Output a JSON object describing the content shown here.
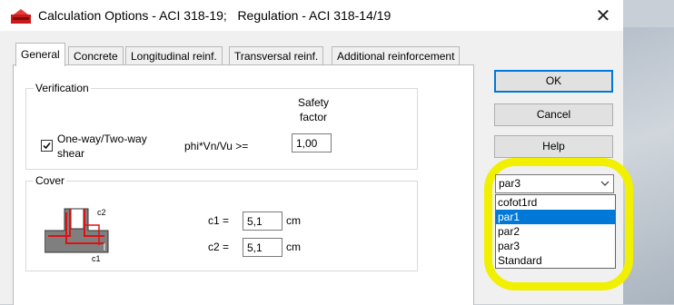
{
  "window": {
    "title": "Calculation Options - ACI 318-19;   Regulation - ACI 318-14/19",
    "close_glyph": "✕"
  },
  "tabs": [
    "General",
    "Concrete",
    "Longitudinal reinf.",
    "Transversal reinf.",
    "Additional reinforcement"
  ],
  "verification": {
    "group_title": "Verification",
    "safety_factor_line1": "Safety",
    "safety_factor_line2": "factor",
    "checkbox_line1": "One-way/Two-way",
    "checkbox_line2": "shear",
    "checkbox_checked": true,
    "formula_label": "phi*Vn/Vu >=",
    "safety_value": "1,00"
  },
  "cover": {
    "group_title": "Cover",
    "c1_label": "c1 =",
    "c1_value": "5,1",
    "c1_unit": "cm",
    "c2_label": "c2 =",
    "c2_value": "5,1",
    "c2_unit": "cm",
    "diagram_c1": "c1",
    "diagram_c2": "c2"
  },
  "buttons": {
    "ok": "OK",
    "cancel": "Cancel",
    "help": "Help"
  },
  "combo": {
    "selected": "par3",
    "options": [
      "cofot1rd",
      "par1",
      "par2",
      "par3",
      "Standard"
    ],
    "highlighted_option": "par1"
  },
  "colors": {
    "accent": "#0078d7",
    "highlight": "#f0f000",
    "rebar": "#e01010"
  }
}
